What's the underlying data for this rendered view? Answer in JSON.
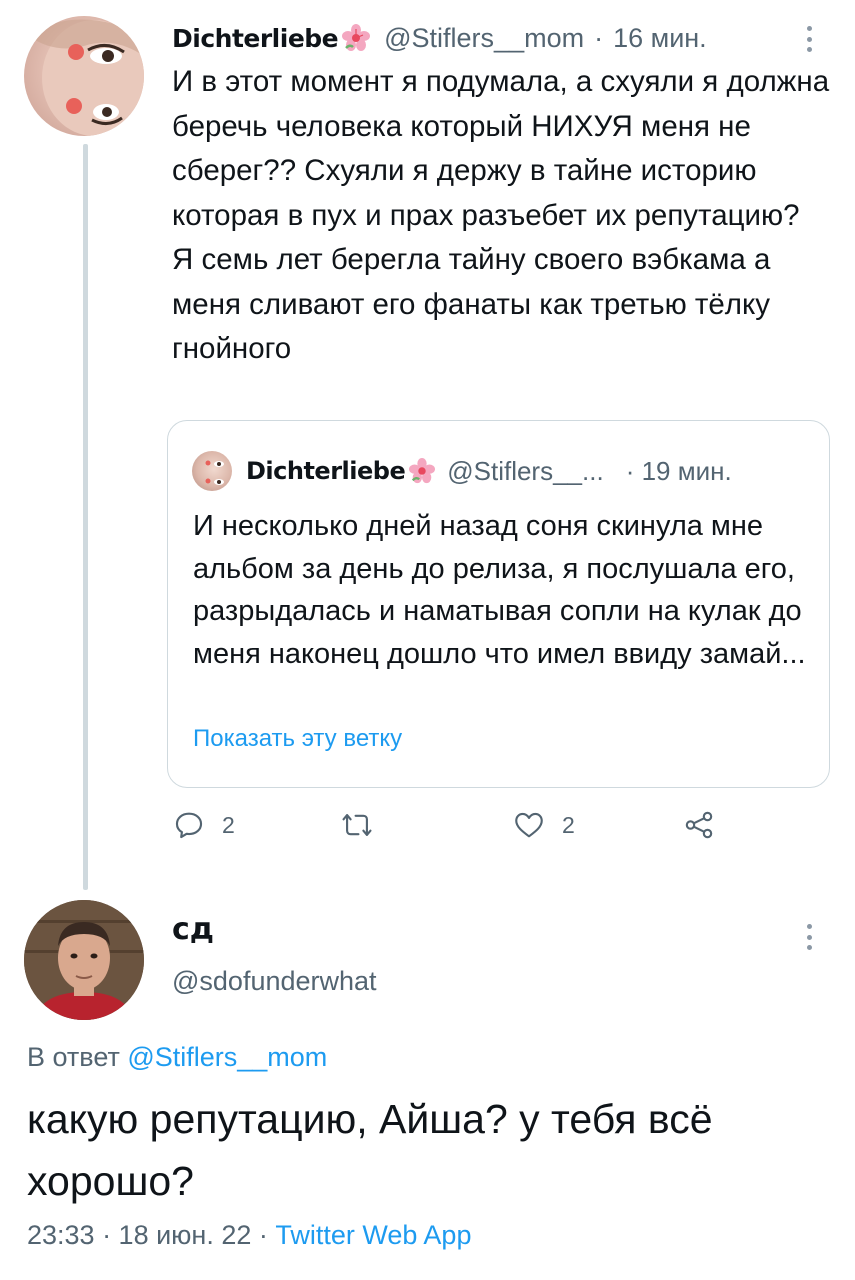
{
  "thread_tweet": {
    "author": {
      "display_name": "Dichterliebe",
      "handle": "@Stiflers__mom",
      "badge_icon": "flower-emoji"
    },
    "time": "16 мин.",
    "separator": "·",
    "text": "И в этот момент я подумала, а схуяли я должна беречь человека который НИХУЯ меня не сберег?? Схуяли я держу в тайне историю которая в пух и прах разъебет их репутацию?\nЯ семь лет берегла тайну своего вэбкама а меня сливают его фанаты как третью тёлку гнойного",
    "quoted_tweet": {
      "display_name": "Dichterliebe",
      "handle": "@Stiflers__...",
      "time": "· 19 мин.",
      "text": "И несколько дней назад соня скинула мне альбом за день до релиза, я послушала его, разрыдалась и наматывая сопли на кулак до меня наконец дошло что имел ввиду замай...",
      "show_thread": "Показать эту ветку"
    },
    "actions": {
      "reply_count": "2",
      "like_count": "2"
    }
  },
  "main_tweet": {
    "author": {
      "display_name": "сд",
      "handle": "@sdofunderwhat"
    },
    "reply_prefix": "В ответ",
    "reply_handle": "@Stiflers__mom",
    "text": "какую репутацию, Айша? у тебя всё хорошо?",
    "timestamp": "23:33 · 18 июн. 22 · ",
    "source": "Twitter Web App"
  },
  "colors": {
    "link": "#1d9bf0",
    "secondary_text": "#536471",
    "border": "#cfd9de"
  }
}
